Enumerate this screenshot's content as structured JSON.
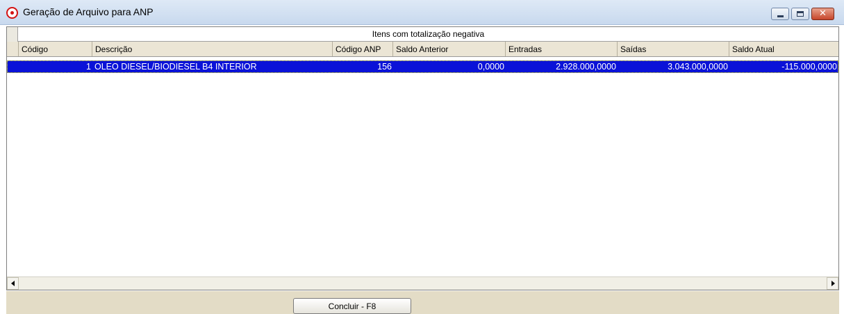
{
  "window": {
    "title": "Geração de Arquivo para ANP",
    "controls": {
      "minimize_icon": "minimize-icon",
      "maximize_icon": "maximize-icon",
      "close_icon": "close-icon"
    },
    "colors": {
      "titlebar": "#c8d9ee",
      "selection": "#0a12d8",
      "header": "#ebe5d5",
      "footer": "#e3dcc6",
      "app_icon": "#d41414"
    }
  },
  "grid": {
    "group_title": "Itens com totalização negativa",
    "columns": [
      "Código",
      "Descrição",
      "Código ANP",
      "Saldo Anterior",
      "Entradas",
      "Saídas",
      "Saldo Atual"
    ],
    "rows": [
      {
        "selected": true,
        "codigo": "1",
        "descricao": "OLEO DIESEL/BIODIESEL B4 INTERIOR",
        "codigo_anp": "156",
        "saldo_anterior": "0,0000",
        "entradas": "2.928.000,0000",
        "saidas": "3.043.000,0000",
        "saldo_atual": "-115.000,0000"
      }
    ]
  },
  "footer": {
    "concluir_label": "Concluir - F8"
  }
}
